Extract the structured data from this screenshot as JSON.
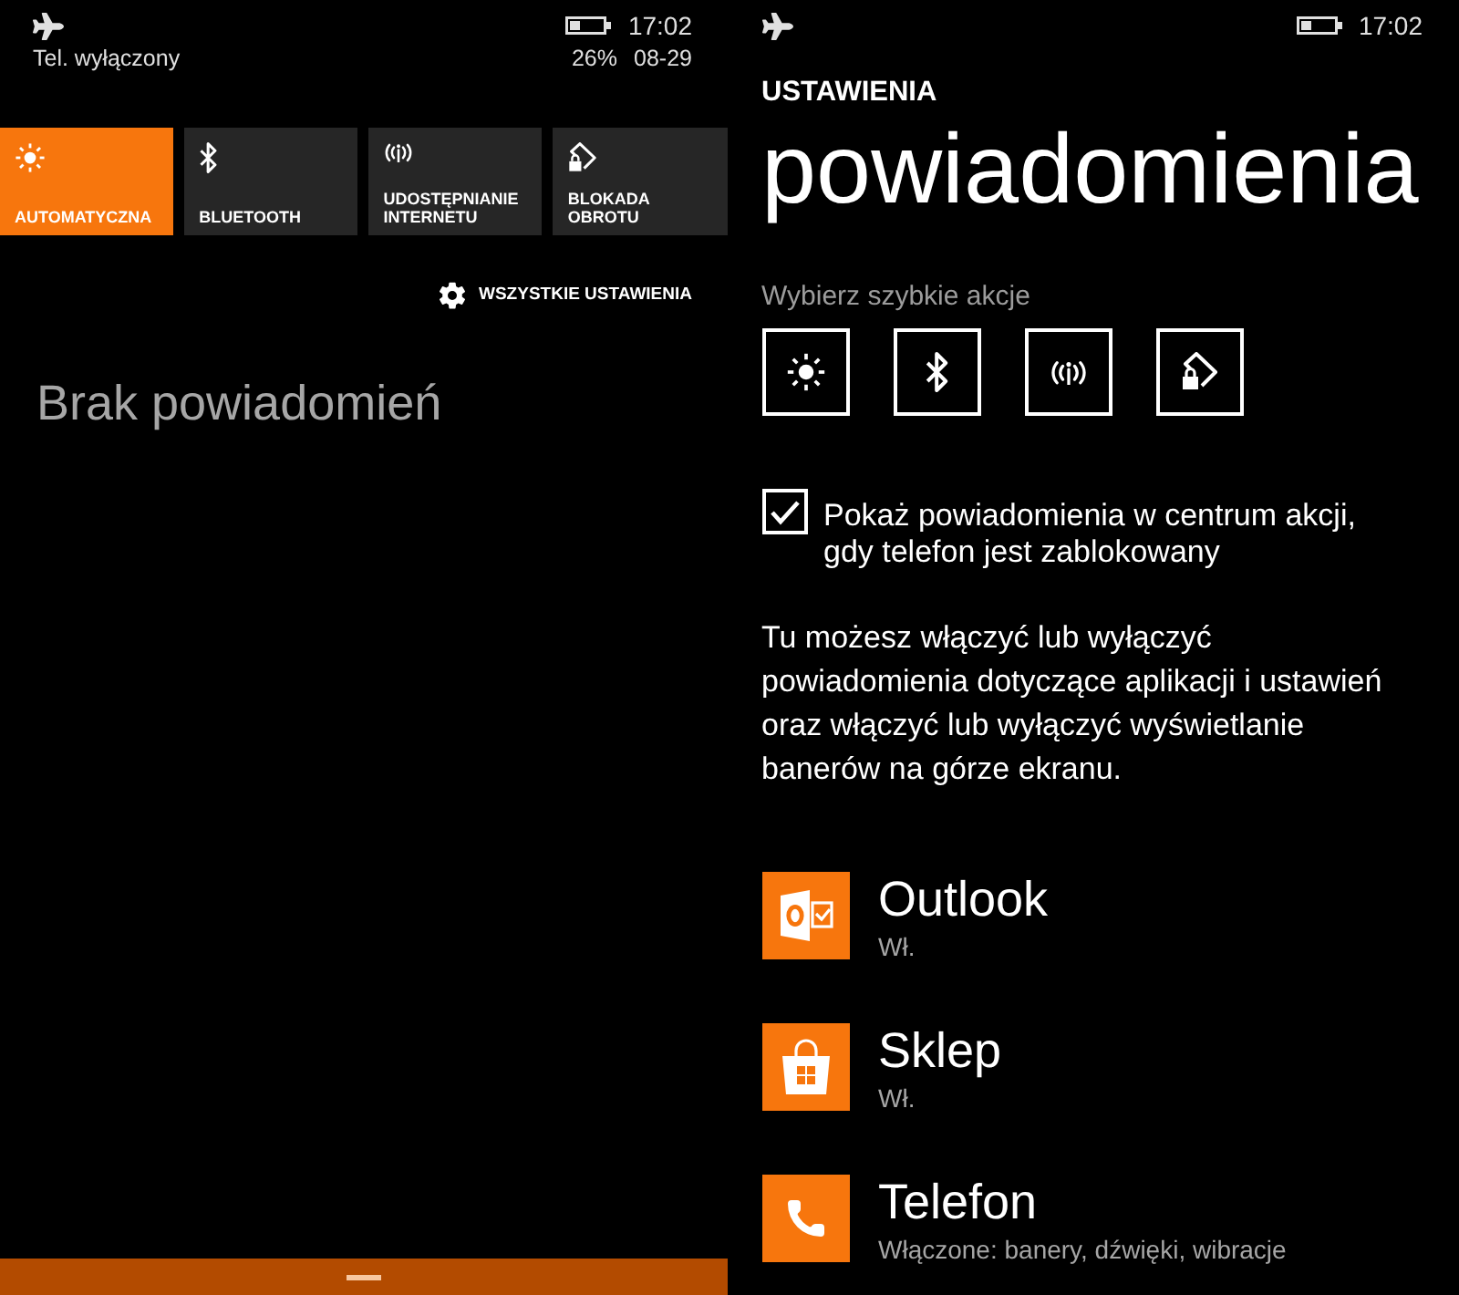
{
  "action_center": {
    "status_bar": {
      "phone_status": "Tel. wyłączony",
      "time": "17:02",
      "battery_percent": "26%",
      "date": "08-29"
    },
    "quick_actions": [
      {
        "kind": "brightness",
        "label": "AUTOMATYCZNA",
        "on": true
      },
      {
        "kind": "bluetooth",
        "label": "BLUETOOTH",
        "on": false
      },
      {
        "kind": "hotspot",
        "label": "UDOSTĘPNIANIE INTERNETU",
        "on": false
      },
      {
        "kind": "rotation_lock",
        "label": "BLOKADA OBROTU",
        "on": false
      }
    ],
    "all_settings_link": "WSZYSTKIE USTAWIENIA",
    "empty_message": "Brak powiadomień"
  },
  "settings_page": {
    "status_bar": {
      "time": "17:02"
    },
    "section": "USTAWIENIA",
    "title": "powiadomienia",
    "quick_actions_label": "Wybierz szybkie akcje",
    "quick_action_slots": [
      {
        "kind": "brightness"
      },
      {
        "kind": "bluetooth"
      },
      {
        "kind": "hotspot"
      },
      {
        "kind": "rotation_lock"
      }
    ],
    "lock_screen_option": {
      "checked": true,
      "label_lines": [
        "Pokaż powiadomienia w centrum akcji,",
        "gdy telefon jest zablokowany"
      ]
    },
    "description_lines": [
      "Tu możesz włączyć lub wyłączyć",
      "powiadomienia dotyczące aplikacji i ustawień",
      "oraz włączyć lub wyłączyć wyświetlanie",
      "banerów na górze ekranu."
    ],
    "apps": [
      {
        "kind": "mail",
        "name": "Outlook",
        "status": "Wł."
      },
      {
        "kind": "store",
        "name": "Sklep",
        "status": "Wł."
      },
      {
        "kind": "phone",
        "name": "Telefon",
        "status": "Włączone: banery, dźwięki, wibracje"
      }
    ]
  }
}
